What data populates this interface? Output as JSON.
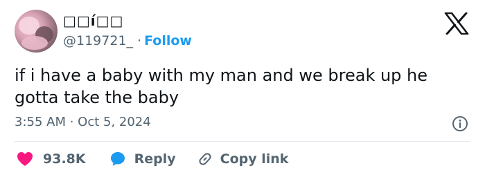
{
  "user": {
    "display_name": "□□í□□",
    "handle": "@119721_",
    "separator": "·",
    "follow_label": "Follow"
  },
  "tweet": {
    "text": "if i have a baby with my man and we break up he gotta take the baby",
    "timestamp": "3:55 AM · Oct 5, 2024"
  },
  "actions": {
    "like_count": "93.8K",
    "reply_label": "Reply",
    "copy_link_label": "Copy link"
  },
  "colors": {
    "accent": "#1d9bf0",
    "like": "#f91880",
    "muted_text": "#536471",
    "primary_text": "#0f1419"
  },
  "icons": {
    "logo": "x-logo-icon",
    "info": "info-icon",
    "like": "heart-icon",
    "reply": "speech-bubble-icon",
    "copy": "link-icon"
  }
}
